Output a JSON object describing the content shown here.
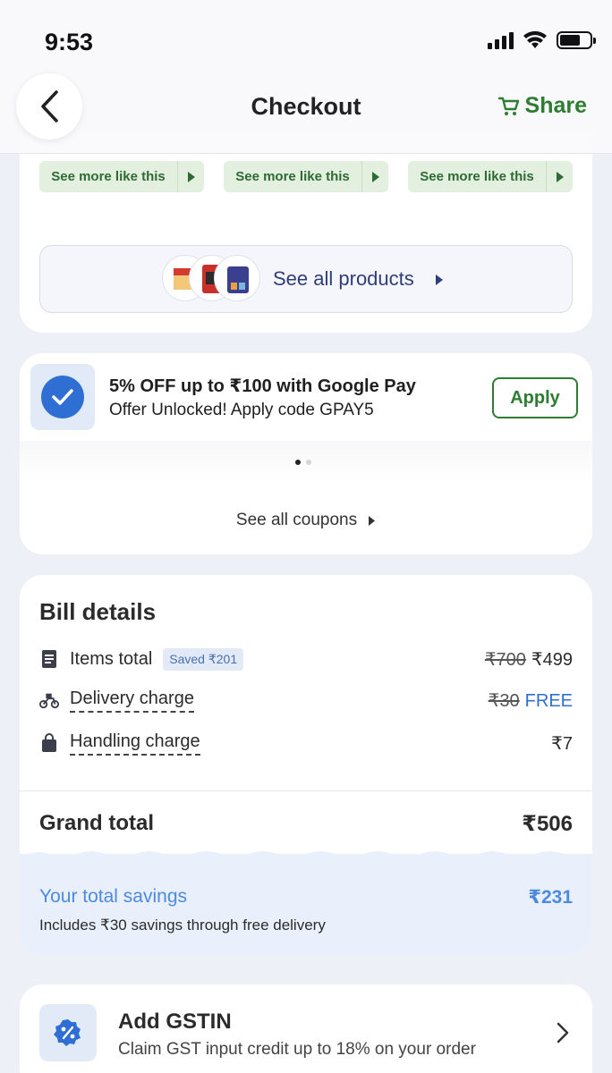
{
  "status_bar": {
    "time": "9:53"
  },
  "header": {
    "title": "Checkout",
    "share_label": "Share"
  },
  "products": {
    "see_more_label": "See more like this",
    "see_all_label": "See all products"
  },
  "coupon": {
    "title": "5% OFF up to ₹100 with Google Pay",
    "subtitle": "Offer Unlocked! Apply code GPAY5",
    "apply_label": "Apply",
    "see_all_label": "See all coupons"
  },
  "bill": {
    "title": "Bill details",
    "items_total": {
      "label": "Items total",
      "saved_badge": "Saved ₹201",
      "old_price": "₹700",
      "price": "₹499"
    },
    "delivery": {
      "label": "Delivery charge",
      "old_price": "₹30",
      "price": "FREE"
    },
    "handling": {
      "label": "Handling charge",
      "price": "₹7"
    },
    "grand_total": {
      "label": "Grand total",
      "value": "₹506"
    },
    "savings": {
      "label": "Your total savings",
      "value": "₹231",
      "note": "Includes ₹30 savings through free delivery"
    }
  },
  "gstin": {
    "title": "Add GSTIN",
    "subtitle": "Claim GST input credit up to 18% on your order"
  },
  "colors": {
    "accent_green": "#2f7d32",
    "accent_blue": "#2f6fd4",
    "savings_blue": "#4c8ae0",
    "background": "#eef0f7"
  }
}
